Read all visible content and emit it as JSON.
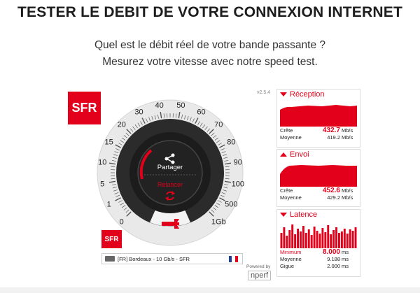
{
  "page": {
    "title": "TESTER LE DEBIT DE VOTRE CONNEXION INTERNET",
    "subtitle_line1": "Quel est le débit réel de votre bande passante ?",
    "subtitle_line2": "Mesurez votre vitesse avec notre speed test."
  },
  "brand": {
    "logo": "SFR",
    "color": "#e2001a"
  },
  "gauge": {
    "ticks": [
      "0",
      "1",
      "5",
      "10",
      "15",
      "20",
      "30",
      "40",
      "50",
      "60",
      "70",
      "80",
      "90",
      "100",
      "500",
      "1Gb"
    ],
    "share_label": "Partager",
    "restart_label": "Relancer",
    "share_icon": "share-icon",
    "restart_icon": "refresh-icon",
    "tool_icon": "wrench-icon"
  },
  "server": {
    "label": "[FR] Bordeaux - 10 Gb/s - SFR",
    "icon": "server-icon",
    "flag": "fr-flag"
  },
  "version": "v2.5.4",
  "powered_by": "Powered by",
  "nperf_logo": "nperf",
  "reception": {
    "title": "Réception",
    "peak_label": "Crête",
    "peak_value": "432.7",
    "peak_unit": "Mb/s",
    "avg_label": "Moyenne",
    "avg_value": "419.2",
    "avg_unit": "Mb/s"
  },
  "envoi": {
    "title": "Envoi",
    "peak_label": "Crête",
    "peak_value": "452.6",
    "peak_unit": "Mb/s",
    "avg_label": "Moyenne",
    "avg_value": "429.2",
    "avg_unit": "Mb/s"
  },
  "latence": {
    "title": "Latence",
    "min_label": "Minimum",
    "min_value": "8.000",
    "min_unit": "ms",
    "avg_label": "Moyenne",
    "avg_value": "9.188",
    "avg_unit": "ms",
    "jitter_label": "Gigue",
    "jitter_value": "2.000",
    "jitter_unit": "ms"
  }
}
